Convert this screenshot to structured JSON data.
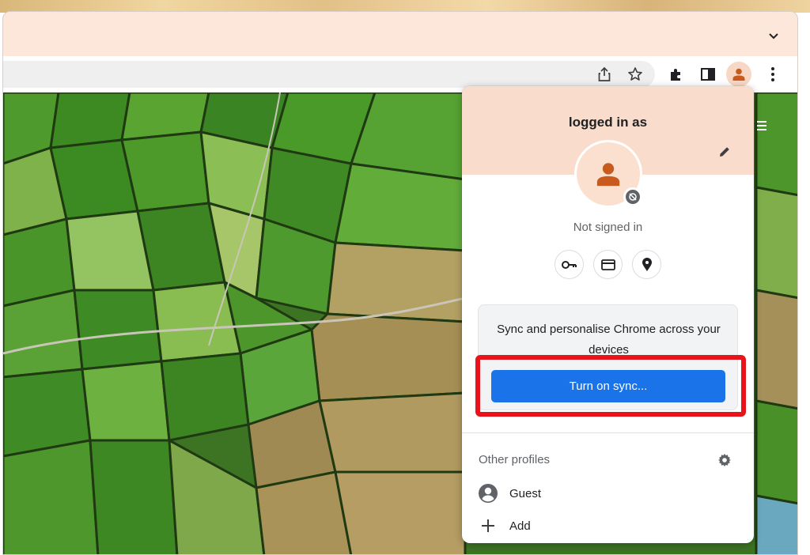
{
  "browser": {
    "tab_strip_icon": "chevron-down-icon",
    "toolbar_icons": [
      "share-icon",
      "star-icon",
      "extensions-icon",
      "side-panel-icon",
      "profile-avatar-icon",
      "more-menu-icon"
    ],
    "accent_color": "#1a73e8",
    "header_color": "#fce7da"
  },
  "profile_menu": {
    "title": "logged in as",
    "status": "Not signed in",
    "quick_actions": [
      "passwords-key-icon",
      "payment-card-icon",
      "location-pin-icon"
    ],
    "sync_promo": "Sync and personalise Chrome across your devices",
    "sync_button": "Turn on sync...",
    "other_profiles_label": "Other profiles",
    "profiles": [
      {
        "label": "Guest",
        "icon": "guest-avatar-icon"
      },
      {
        "label": "Add",
        "icon": "add-icon"
      }
    ]
  }
}
